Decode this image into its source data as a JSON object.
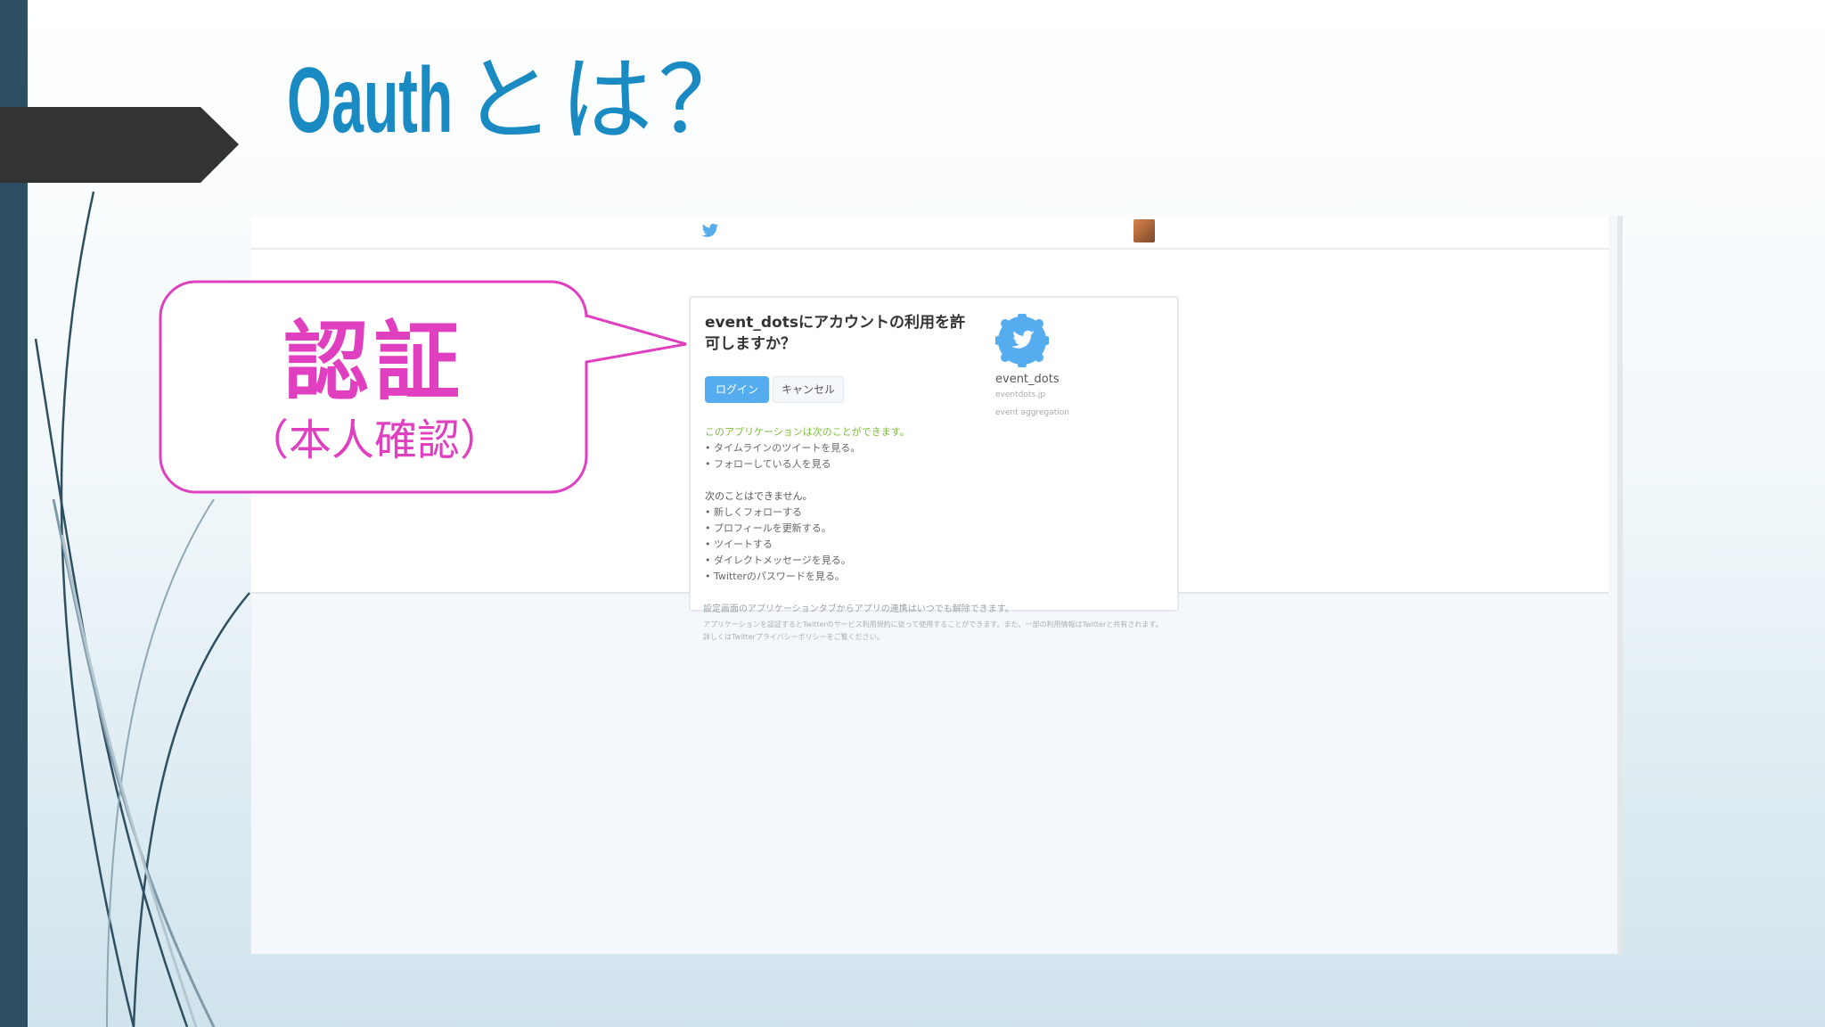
{
  "slide": {
    "title_latin": "Oauth",
    "title_jp": "とは？"
  },
  "callout": {
    "main": "認証",
    "sub": "（本人確認）"
  },
  "screenshot": {
    "heading": "event_dotsにアカウントの利用を許可しますか？",
    "login_label": "ログイン",
    "cancel_label": "キャンセル",
    "can_heading": "このアプリケーションは次のことができます。",
    "can_items": [
      "タイムラインのツイートを見る。",
      "フォローしている人を見る"
    ],
    "cannot_heading": "次のことはできません。",
    "cannot_items": [
      "新しくフォローする",
      "プロフィールを更新する。",
      "ツイートする",
      "ダイレクトメッセージを見る。",
      "Twitterのパスワードを見る。"
    ],
    "app_name": "event_dots",
    "app_url": "eventdots.jp",
    "app_desc": "event aggregation",
    "footer_note": "設定画面のアプリケーションタブからアプリの連携はいつでも解除できます。",
    "footer_small": "アプリケーションを認証するとTwitterのサービス利用規約に従って使用することができます。また、一部の利用情報はTwitterと共有されます。詳しくはTwitterプライバシーポリシーをご覧ください。"
  },
  "colors": {
    "title": "#1a8ac3",
    "callout": "#e03fbf",
    "left_bar": "#2e4f61",
    "twitter_blue": "#55acee"
  },
  "icons": [
    "twitter-bird-icon",
    "avatar",
    "app-logo-icon"
  ]
}
